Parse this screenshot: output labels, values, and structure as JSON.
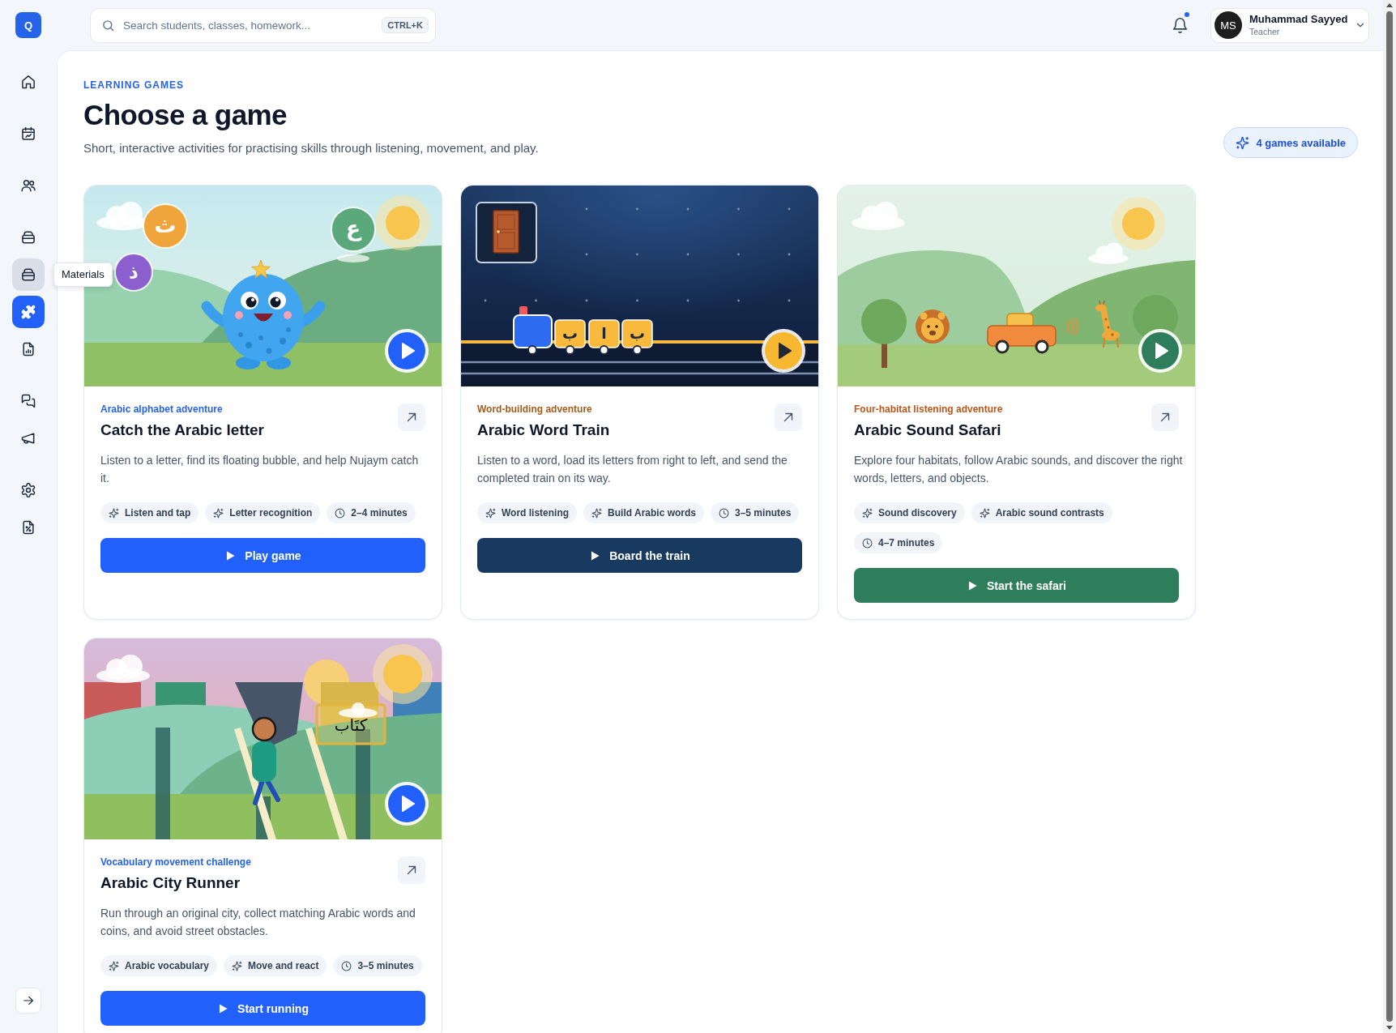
{
  "sidebar": {
    "logo": "Q",
    "groups": [
      {
        "items": [
          {
            "selected": false,
            "hovered": false
          }
        ]
      },
      {
        "items": [
          {
            "selected": false,
            "hovered": false
          }
        ]
      },
      {
        "items": [
          {
            "selected": false,
            "hovered": false
          }
        ]
      },
      {
        "items": [
          {
            "selected": false,
            "hovered": false
          },
          {
            "selected": false,
            "hovered": true,
            "tooltip": "Materials"
          },
          {
            "selected": true,
            "hovered": false
          },
          {
            "selected": false,
            "hovered": false
          }
        ]
      },
      {
        "items": [
          {
            "selected": false,
            "hovered": false
          },
          {
            "selected": false,
            "hovered": false
          }
        ]
      },
      {
        "items": [
          {
            "selected": false,
            "hovered": false
          },
          {
            "selected": false,
            "hovered": false
          }
        ]
      }
    ]
  },
  "top_bar": {
    "search": {
      "placeholder": "Search students, classes, homework...",
      "shortcut": "CTRL+K"
    },
    "notifications": {
      "unread": true
    },
    "user": {
      "initials": "MS",
      "name": "Muhammad Sayyed",
      "role": "Teacher"
    }
  },
  "header": {
    "eyebrow": "LEARNING GAMES",
    "title": "Choose a game",
    "subtitle": "Short, interactive activities for practising skills through listening, movement, and play.",
    "badge": "4 games available"
  },
  "cards": [
    {
      "category": {
        "text": "Arabic alphabet adventure",
        "color": "#2563eb"
      },
      "title": "Catch the Arabic letter",
      "description": "Listen to a letter, find its floating bubble, and help Nujaym catch it.",
      "tags": [
        {
          "kind": "skill",
          "text": "Listen and tap"
        },
        {
          "kind": "skill",
          "text": "Letter recognition"
        },
        {
          "kind": "duration",
          "text": "2–4 minutes"
        }
      ],
      "button": {
        "label": "Play game",
        "color": "#2160fa"
      },
      "scene": {
        "kind": "monster",
        "play_button": {
          "color": "#2160fa"
        },
        "letters": [
          "ث",
          "ع",
          "ذ"
        ]
      }
    },
    {
      "category": {
        "text": "Word-building adventure",
        "color": "#a35c18"
      },
      "title": "Arabic Word Train",
      "description": "Listen to a word, load its letters from right to left, and send the completed train on its way.",
      "tags": [
        {
          "kind": "skill",
          "text": "Word listening"
        },
        {
          "kind": "skill",
          "text": "Build Arabic words"
        },
        {
          "kind": "duration",
          "text": "3–5 minutes"
        }
      ],
      "button": {
        "label": "Board the train",
        "color": "#183a60"
      },
      "scene": {
        "kind": "train",
        "play_button": {
          "color": "#f7b731"
        },
        "letters": [
          "ب",
          "ا",
          "ب"
        ]
      }
    },
    {
      "category": {
        "text": "Four-habitat listening adventure",
        "color": "#b8561b"
      },
      "title": "Arabic Sound Safari",
      "description": "Explore four habitats, follow Arabic sounds, and discover the right words, letters, and objects.",
      "tags": [
        {
          "kind": "skill",
          "text": "Sound discovery"
        },
        {
          "kind": "skill",
          "text": "Arabic sound contrasts"
        },
        {
          "kind": "duration",
          "text": "4–7 minutes"
        }
      ],
      "button": {
        "label": "Start the safari",
        "color": "#2e7d5b"
      },
      "scene": {
        "kind": "safari",
        "play_button": {
          "color": "#2e7d5b"
        }
      }
    },
    {
      "category": {
        "text": "Vocabulary movement challenge",
        "color": "#2563eb"
      },
      "title": "Arabic City Runner",
      "description": "Run through an original city, collect matching Arabic words and coins, and avoid street obstacles.",
      "tags": [
        {
          "kind": "skill",
          "text": "Arabic vocabulary"
        },
        {
          "kind": "skill",
          "text": "Move and react"
        },
        {
          "kind": "duration",
          "text": "3–5 minutes"
        }
      ],
      "button": {
        "label": "Start running",
        "color": "#2160fa"
      },
      "scene": {
        "kind": "runner",
        "play_button": {
          "color": "#2160fa"
        },
        "sign": "كتَاب"
      }
    }
  ]
}
